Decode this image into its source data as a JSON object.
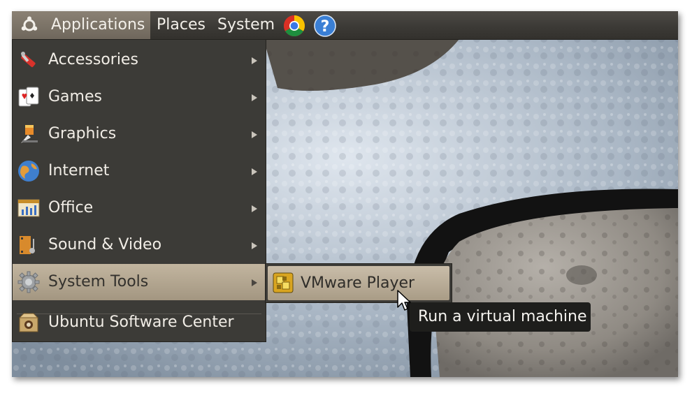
{
  "panel": {
    "applications_label": "Applications",
    "places_label": "Places",
    "system_label": "System",
    "icons": [
      "ubuntu-logo-icon",
      "chrome-icon",
      "help-icon"
    ]
  },
  "menu": {
    "items": [
      {
        "label": "Accessories",
        "icon": "accessories-icon",
        "has_submenu": true
      },
      {
        "label": "Games",
        "icon": "games-icon",
        "has_submenu": true
      },
      {
        "label": "Graphics",
        "icon": "graphics-icon",
        "has_submenu": true
      },
      {
        "label": "Internet",
        "icon": "internet-icon",
        "has_submenu": true
      },
      {
        "label": "Office",
        "icon": "office-icon",
        "has_submenu": true
      },
      {
        "label": "Sound & Video",
        "icon": "sound-video-icon",
        "has_submenu": true
      },
      {
        "label": "System Tools",
        "icon": "system-tools-icon",
        "has_submenu": true,
        "active": true
      },
      {
        "label": "Ubuntu Software Center",
        "icon": "software-center-icon",
        "has_submenu": false
      }
    ]
  },
  "submenu": {
    "items": [
      {
        "label": "VMware Player",
        "icon": "vmware-player-icon",
        "highlighted": true
      }
    ]
  },
  "tooltip": {
    "text": "Run a virtual machine"
  },
  "colors": {
    "panel": "#3c3a36",
    "menu_bg": "#3c3b37",
    "highlight": "#b3a792",
    "tooltip_bg": "#1e1e1c"
  }
}
